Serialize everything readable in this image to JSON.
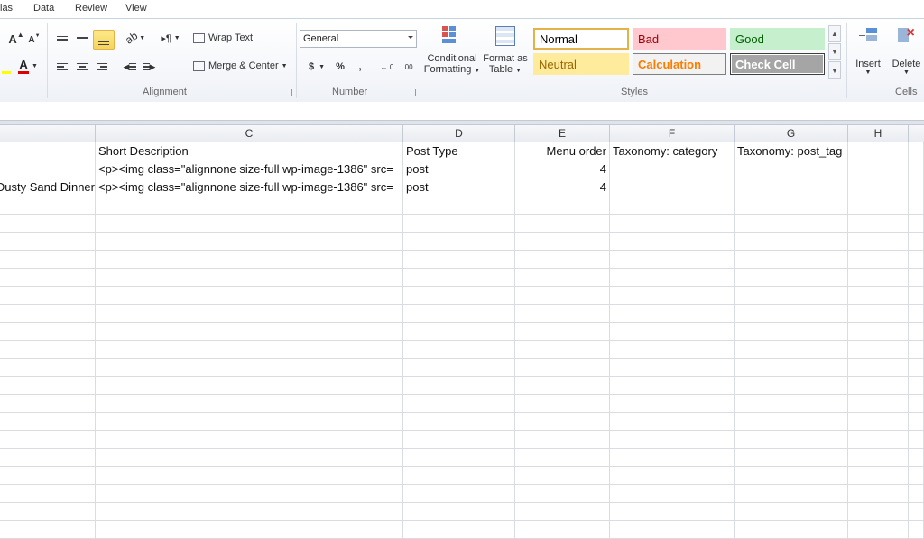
{
  "menu": {
    "tabs": [
      "las",
      "Data",
      "Review",
      "View"
    ]
  },
  "ribbon": {
    "alignment": {
      "label": "Alignment",
      "wrap_text": "Wrap Text",
      "merge_center": "Merge & Center"
    },
    "number": {
      "label": "Number",
      "format": "General",
      "currency": "$",
      "percent": "%",
      "comma": ","
    },
    "conditional_formatting": {
      "line1": "Conditional",
      "line2": "Formatting"
    },
    "format_as_table": {
      "line1": "Format as",
      "line2": "Table"
    },
    "styles": {
      "label": "Styles",
      "items": [
        {
          "name": "Normal",
          "bg": "#ffffff",
          "fg": "#000000",
          "border": "#e3b34a"
        },
        {
          "name": "Bad",
          "bg": "#ffc7ce",
          "fg": "#9c0006",
          "border": "#ffc7ce"
        },
        {
          "name": "Good",
          "bg": "#c6efce",
          "fg": "#006100",
          "border": "#c6efce"
        },
        {
          "name": "Neutral",
          "bg": "#ffeb9c",
          "fg": "#9c6500",
          "border": "#ffeb9c"
        },
        {
          "name": "Calculation",
          "bg": "#f2f2f2",
          "fg": "#fa7d00",
          "border": "#7f7f7f"
        },
        {
          "name": "Check Cell",
          "bg": "#a5a5a5",
          "fg": "#ffffff",
          "border": "#3f3f3f"
        }
      ]
    },
    "cells": {
      "label": "Cells",
      "insert": "Insert",
      "delete": "Delete"
    }
  },
  "sheet": {
    "columns": [
      "C",
      "D",
      "E",
      "F",
      "G",
      "H"
    ],
    "rows": [
      {
        "b": "",
        "c": "Short Description",
        "d": "Post Type",
        "e": "Menu order",
        "f": "Taxonomy: category",
        "g": "Taxonomy: post_tag"
      },
      {
        "b": "",
        "c": "<p><img class=\"alignnone size-full wp-image-1386\" src=",
        "d": "post",
        "e": "4",
        "f": "",
        "g": ""
      },
      {
        "b": "Dusty Sand Dinner",
        "c": "<p><img class=\"alignnone size-full wp-image-1386\" src=",
        "d": "post",
        "e": "4",
        "f": "",
        "g": ""
      }
    ]
  }
}
